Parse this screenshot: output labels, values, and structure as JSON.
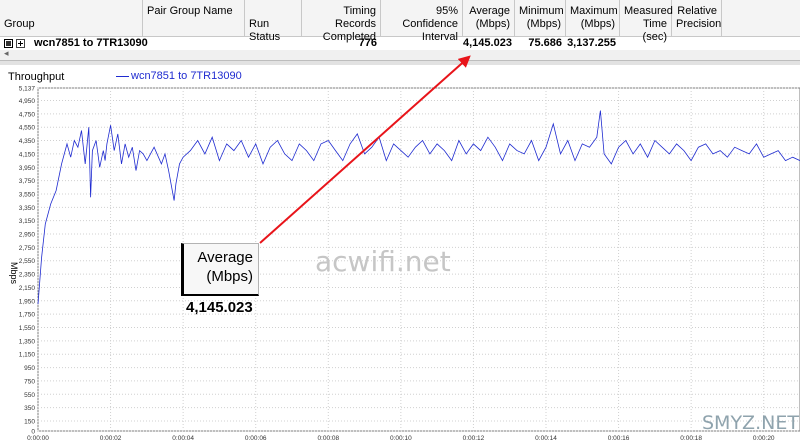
{
  "table": {
    "columns": [
      {
        "label": "Group"
      },
      {
        "label": "Pair Group Name"
      },
      {
        "label": "Run Status"
      },
      {
        "label": "Timing Records Completed"
      },
      {
        "label": "95% Confidence Interval"
      },
      {
        "label": "Average (Mbps)"
      },
      {
        "label": "Minimum (Mbps)"
      },
      {
        "label": "Maximum (Mbps)"
      },
      {
        "label": "Measured Time (sec)"
      },
      {
        "label": "Relative Precision"
      }
    ],
    "row": {
      "pair": "wcn7851 to 7TR13090",
      "records": "776",
      "average": "4,145.023",
      "minimum": "75.686",
      "maximum": "3,137.255"
    }
  },
  "callout": {
    "label": "Average (Mbps)",
    "value": "4,145.023"
  },
  "watermarks": {
    "center": "acwifi.net",
    "corner": "SMYZ.NET"
  },
  "colors": {
    "series": "#1f2bd0",
    "arrow": "#e8141a"
  },
  "chart_data": {
    "type": "line",
    "title": "Throughput",
    "ylabel": "Mbps",
    "xlabel": "",
    "ylim": [
      0,
      5137
    ],
    "xlim": [
      0,
      21
    ],
    "grid": true,
    "legend_position": "top-left",
    "yticks": [
      0,
      150,
      350,
      550,
      750,
      950,
      1150,
      1350,
      1550,
      1750,
      1950,
      2150,
      2350,
      2550,
      2750,
      2950,
      3150,
      3350,
      3550,
      3750,
      3950,
      4150,
      4350,
      4550,
      4750,
      4950,
      5137
    ],
    "ytick_labels": [
      "0",
      "150",
      "350",
      "550",
      "750",
      "950",
      "1,150",
      "1,350",
      "1,550",
      "1,750",
      "1,950",
      "2,150",
      "2,350",
      "2,550",
      "2,750",
      "2,950",
      "3,150",
      "3,350",
      "3,550",
      "3,750",
      "3,950",
      "4,150",
      "4,350",
      "4,550",
      "4,750",
      "4,950",
      "5,137"
    ],
    "xticks": [
      0,
      2,
      4,
      6,
      8,
      10,
      12,
      14,
      16,
      18,
      20
    ],
    "xtick_labels": [
      "0:00:00",
      "0:00:02",
      "0:00:04",
      "0:00:06",
      "0:00:08",
      "0:00:10",
      "0:00:12",
      "0:00:14",
      "0:00:16",
      "0:00:18",
      "0:00:20"
    ],
    "series": [
      {
        "name": "wcn7851 to 7TR13090",
        "x": [
          0,
          0.1,
          0.2,
          0.35,
          0.5,
          0.65,
          0.8,
          0.9,
          1.0,
          1.1,
          1.2,
          1.3,
          1.4,
          1.45,
          1.5,
          1.6,
          1.7,
          1.8,
          1.85,
          1.9,
          2.0,
          2.1,
          2.2,
          2.3,
          2.4,
          2.5,
          2.6,
          2.7,
          2.8,
          2.9,
          3.0,
          3.2,
          3.4,
          3.5,
          3.6,
          3.75,
          3.8,
          3.9,
          4.0,
          4.2,
          4.4,
          4.6,
          4.8,
          5.0,
          5.2,
          5.4,
          5.6,
          5.8,
          6.0,
          6.2,
          6.4,
          6.6,
          6.8,
          7.0,
          7.2,
          7.4,
          7.6,
          7.8,
          8.0,
          8.2,
          8.4,
          8.6,
          8.8,
          9.0,
          9.2,
          9.4,
          9.6,
          9.8,
          10.0,
          10.2,
          10.4,
          10.6,
          10.8,
          11.0,
          11.2,
          11.4,
          11.6,
          11.8,
          12.0,
          12.2,
          12.4,
          12.6,
          12.8,
          13.0,
          13.2,
          13.4,
          13.6,
          13.8,
          14.0,
          14.2,
          14.4,
          14.6,
          14.8,
          15.0,
          15.2,
          15.4,
          15.5,
          15.6,
          15.8,
          16.0,
          16.2,
          16.4,
          16.6,
          16.8,
          17.0,
          17.2,
          17.4,
          17.6,
          17.8,
          18.0,
          18.2,
          18.4,
          18.6,
          18.8,
          19.0,
          19.2,
          19.4,
          19.6,
          19.8,
          20.0,
          20.2,
          20.4,
          20.6,
          20.8,
          21.0
        ],
        "y": [
          1900,
          2600,
          3100,
          3400,
          3600,
          4000,
          4300,
          4100,
          4350,
          4250,
          4500,
          4000,
          4550,
          3500,
          4200,
          4350,
          3950,
          4200,
          4050,
          4300,
          4580,
          4200,
          4450,
          4000,
          4300,
          4100,
          4250,
          3900,
          4200,
          4150,
          4050,
          4250,
          4000,
          4150,
          3900,
          3450,
          3700,
          4000,
          4100,
          4200,
          4350,
          4150,
          4400,
          4050,
          4300,
          4200,
          4350,
          4100,
          4300,
          4000,
          4250,
          4350,
          4150,
          4050,
          4300,
          4200,
          4050,
          4300,
          4350,
          4200,
          4050,
          4300,
          4450,
          4150,
          4250,
          4400,
          4050,
          4300,
          4200,
          4100,
          4250,
          4350,
          4150,
          4300,
          4200,
          4050,
          4350,
          4150,
          4300,
          4200,
          4400,
          4250,
          4050,
          4300,
          4200,
          4150,
          4350,
          4050,
          4250,
          4600,
          4150,
          4350,
          4050,
          4300,
          4250,
          4400,
          4800,
          4150,
          4000,
          4250,
          4350,
          4150,
          4300,
          4100,
          4350,
          4250,
          4150,
          4300,
          4200,
          4050,
          4250,
          4300,
          4150,
          4200,
          4100,
          4250,
          4200,
          4150,
          4300,
          4100,
          4150,
          4200,
          4050,
          4100,
          4050
        ]
      }
    ]
  }
}
